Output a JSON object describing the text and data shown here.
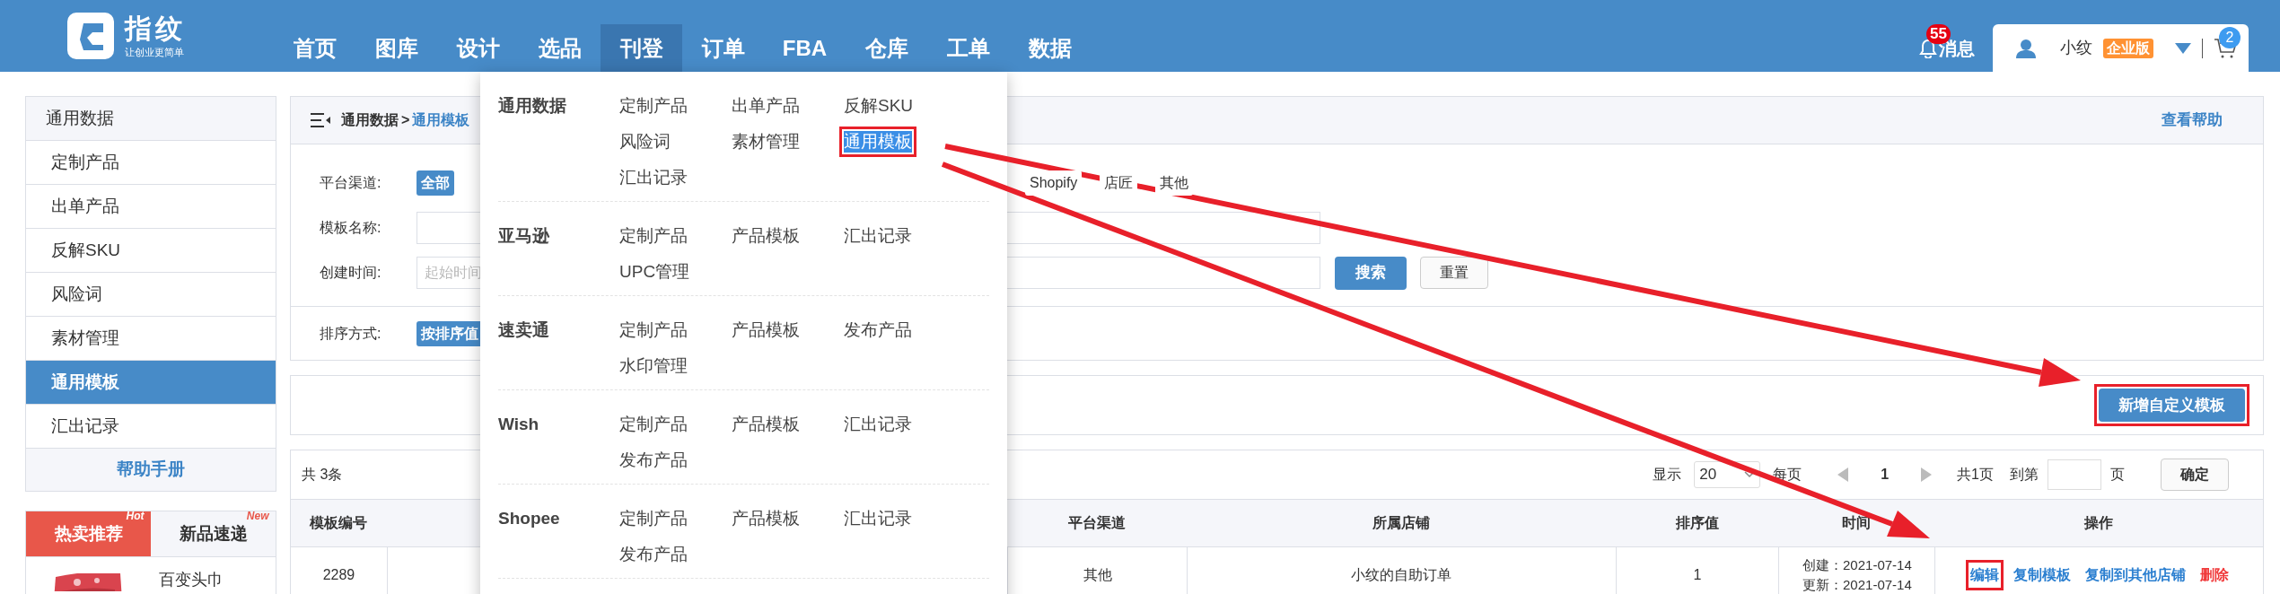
{
  "header": {
    "logo": {
      "name": "指纹",
      "slogan": "让创业更简单"
    },
    "nav": [
      {
        "label": "首页",
        "selected": false
      },
      {
        "label": "图库",
        "selected": false
      },
      {
        "label": "设计",
        "selected": false
      },
      {
        "label": "选品",
        "selected": false
      },
      {
        "label": "刊登",
        "selected": true
      },
      {
        "label": "订单",
        "selected": false
      },
      {
        "label": "FBA",
        "selected": false
      },
      {
        "label": "仓库",
        "selected": false
      },
      {
        "label": "工单",
        "selected": false
      },
      {
        "label": "数据",
        "selected": false
      }
    ],
    "messages": {
      "label": "消息",
      "badge": "55"
    },
    "user": {
      "name": "小纹",
      "edition": "企业版"
    },
    "cart": {
      "badge": "2"
    }
  },
  "dropdown": {
    "sections": [
      {
        "title": "通用数据",
        "items": [
          {
            "label": "定制产品",
            "selected": false,
            "highlighted": false
          },
          {
            "label": "出单产品",
            "selected": false,
            "highlighted": false
          },
          {
            "label": "反解SKU",
            "selected": false,
            "highlighted": false
          },
          {
            "label": "风险词",
            "selected": false,
            "highlighted": false
          },
          {
            "label": "素材管理",
            "selected": false,
            "highlighted": false
          },
          {
            "label": "通用模板",
            "selected": true,
            "highlighted": true
          },
          {
            "label": "汇出记录",
            "selected": false,
            "highlighted": false
          }
        ]
      },
      {
        "title": "亚马逊",
        "items": [
          {
            "label": "定制产品",
            "selected": false,
            "highlighted": false
          },
          {
            "label": "产品模板",
            "selected": false,
            "highlighted": false
          },
          {
            "label": "汇出记录",
            "selected": false,
            "highlighted": false
          },
          {
            "label": "UPC管理",
            "selected": false,
            "highlighted": false
          }
        ]
      },
      {
        "title": "速卖通",
        "items": [
          {
            "label": "定制产品",
            "selected": false,
            "highlighted": false
          },
          {
            "label": "产品模板",
            "selected": false,
            "highlighted": false
          },
          {
            "label": "发布产品",
            "selected": false,
            "highlighted": false
          },
          {
            "label": "水印管理",
            "selected": false,
            "highlighted": false
          }
        ]
      },
      {
        "title": "Wish",
        "items": [
          {
            "label": "定制产品",
            "selected": false,
            "highlighted": false
          },
          {
            "label": "产品模板",
            "selected": false,
            "highlighted": false
          },
          {
            "label": "汇出记录",
            "selected": false,
            "highlighted": false
          },
          {
            "label": "发布产品",
            "selected": false,
            "highlighted": false
          }
        ]
      },
      {
        "title": "Shopee",
        "items": [
          {
            "label": "定制产品",
            "selected": false,
            "highlighted": false
          },
          {
            "label": "产品模板",
            "selected": false,
            "highlighted": false
          },
          {
            "label": "汇出记录",
            "selected": false,
            "highlighted": false
          },
          {
            "label": "发布产品",
            "selected": false,
            "highlighted": false
          }
        ]
      }
    ]
  },
  "sidebar": {
    "title": "通用数据",
    "items": [
      {
        "label": "定制产品",
        "selected": false
      },
      {
        "label": "出单产品",
        "selected": false
      },
      {
        "label": "反解SKU",
        "selected": false
      },
      {
        "label": "风险词",
        "selected": false
      },
      {
        "label": "素材管理",
        "selected": false
      },
      {
        "label": "通用模板",
        "selected": true
      },
      {
        "label": "汇出记录",
        "selected": false
      }
    ],
    "footer": "帮助手册",
    "promo_tabs": [
      {
        "label": "热卖推荐",
        "tag": "Hot",
        "selected": true
      },
      {
        "label": "新品速递",
        "tag": "New",
        "selected": false
      }
    ],
    "products": [
      {
        "name": "百变头巾",
        "kind": "picture"
      }
    ]
  },
  "breadcrumb": {
    "parent": "通用数据",
    "separator": ">",
    "current": "通用模板",
    "help": "查看帮助"
  },
  "filters": {
    "platform": {
      "label": "平台渠道:",
      "options": [
        {
          "label": "全部",
          "selected": true
        },
        {
          "label": "Shopify",
          "selected": false
        },
        {
          "label": "店匠",
          "selected": false
        },
        {
          "label": "其他",
          "selected": false
        }
      ]
    },
    "name": {
      "label": "模板名称:"
    },
    "created": {
      "label": "创建时间:",
      "placeholder": "起始时间"
    },
    "search_button": "搜索",
    "reset_button": "重置",
    "sort": {
      "label": "排序方式:",
      "options": [
        {
          "label": "按排序值",
          "selected": true
        }
      ]
    }
  },
  "actions": {
    "add_button": {
      "label": "新增自定义模板",
      "highlighted": true
    }
  },
  "table": {
    "total": "共 3条",
    "pagination": {
      "show": "显示",
      "page_size": "20",
      "per_page": "每页",
      "page": "1",
      "pages": "共1页",
      "goto": "到第",
      "page_unit": "页",
      "confirm": "确定"
    },
    "columns": [
      "模板编号",
      null,
      "平台渠道",
      "所属店铺",
      "排序值",
      "时间",
      "操作"
    ],
    "rows": [
      {
        "id": "2289",
        "platform": "其他",
        "shop": "小纹的自助订单",
        "order": "1",
        "created": "创建：2021-07-14",
        "updated": "更新：2021-07-14",
        "actions": [
          {
            "label": "编辑",
            "kind": "link",
            "highlighted": true
          },
          {
            "label": "复制模板",
            "kind": "link",
            "highlighted": false
          },
          {
            "label": "复制到其他店铺",
            "kind": "link",
            "highlighted": false
          },
          {
            "label": "删除",
            "kind": "danger",
            "highlighted": false
          }
        ]
      }
    ]
  }
}
